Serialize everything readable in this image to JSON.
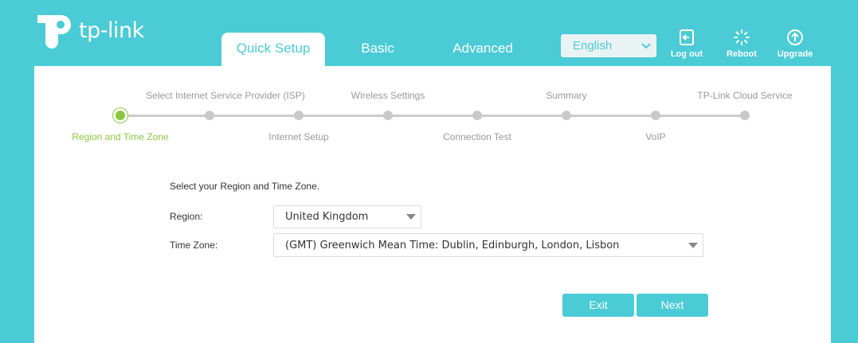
{
  "brand": {
    "name": "tp-link"
  },
  "tabs": [
    {
      "label": "Quick Setup",
      "active": true
    },
    {
      "label": "Basic",
      "active": false
    },
    {
      "label": "Advanced",
      "active": false
    }
  ],
  "language": {
    "selected": "English"
  },
  "tools": {
    "logout": {
      "label": "Log out",
      "icon": "logout-icon"
    },
    "reboot": {
      "label": "Reboot",
      "icon": "reboot-icon"
    },
    "upgrade": {
      "label": "Upgrade",
      "icon": "upgrade-icon"
    }
  },
  "steps": [
    {
      "label": "Region and Time Zone",
      "current": true
    },
    {
      "label": "Select Internet Service Provider (ISP)",
      "current": false
    },
    {
      "label": "Internet Setup",
      "current": false
    },
    {
      "label": "Wireless Settings",
      "current": false
    },
    {
      "label": "Connection Test",
      "current": false
    },
    {
      "label": "Summary",
      "current": false
    },
    {
      "label": "VoIP",
      "current": false
    },
    {
      "label": "TP-Link Cloud Service",
      "current": false
    }
  ],
  "form": {
    "intro": "Select your Region and Time Zone.",
    "region_label": "Region:",
    "region_value": "United Kingdom",
    "timezone_label": "Time Zone:",
    "timezone_value": "(GMT) Greenwich Mean Time: Dublin, Edinburgh, London, Lisbon"
  },
  "buttons": {
    "exit": "Exit",
    "next": "Next"
  },
  "colors": {
    "accent": "#4acbd6",
    "current_step": "#8cc63f"
  }
}
